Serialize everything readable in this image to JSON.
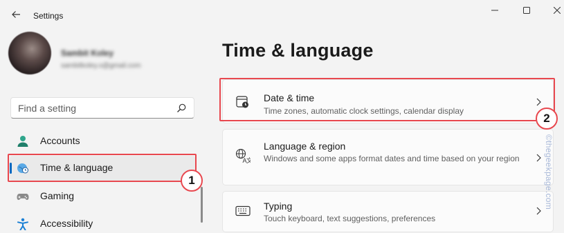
{
  "window": {
    "title": "Settings"
  },
  "profile": {
    "name": "Sambit Koley",
    "email": "sambitkoley.s@gmail.com"
  },
  "search": {
    "placeholder": "Find a setting"
  },
  "nav": {
    "items": [
      {
        "label": "Accounts",
        "icon": "person-icon"
      },
      {
        "label": "Time & language",
        "icon": "globe-clock-icon",
        "active": true
      },
      {
        "label": "Gaming",
        "icon": "gamepad-icon"
      },
      {
        "label": "Accessibility",
        "icon": "accessibility-icon"
      }
    ]
  },
  "page": {
    "title": "Time & language"
  },
  "cards": [
    {
      "title": "Date & time",
      "description": "Time zones, automatic clock settings, calendar display",
      "icon": "calendar-clock-icon"
    },
    {
      "title": "Language & region",
      "description": "Windows and some apps format dates and time based on your region",
      "icon": "language-icon"
    },
    {
      "title": "Typing",
      "description": "Touch keyboard, text suggestions, preferences",
      "icon": "keyboard-icon"
    }
  ],
  "annotations": {
    "badge1": "1",
    "badge2": "2",
    "color": "#e8474e"
  },
  "watermark": "©thegeekpage.com",
  "colors": {
    "accent": "#0067c0",
    "background": "#f3f3f3",
    "card": "#fbfbfb"
  }
}
